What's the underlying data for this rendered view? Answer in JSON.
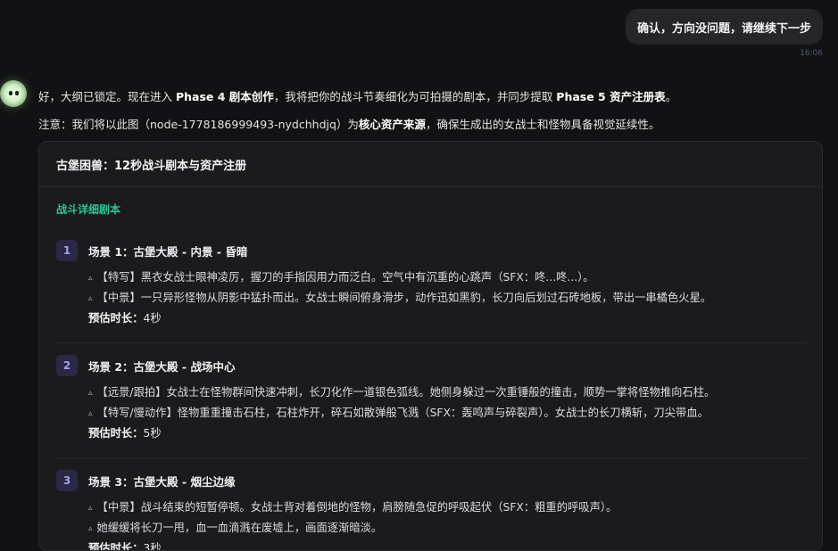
{
  "user_message": {
    "text": "确认，方向没问题，请继续下一步",
    "time": "16:06"
  },
  "assistant": {
    "intro_parts": [
      "好，大纲已锁定。现在进入 ",
      "Phase 4 剧本创作",
      "，我将把你的战斗节奏细化为可拍摄的剧本，并同步提取 ",
      "Phase 5 资产注册表",
      "。"
    ],
    "note_parts": [
      "注意：我们将以此图（node-1778186999493-nydchhdjq）为",
      "核心资产来源",
      "，确保生成出的女战士和怪物具备视觉延续性。"
    ]
  },
  "card": {
    "title": "古堡困兽：12秒战斗剧本与资产注册",
    "section_title": "战斗详细剧本",
    "duration_label": "预估时长：",
    "scenes": [
      {
        "num": "1",
        "title": "场景 1：古堡大殿 - 内景 - 昏暗",
        "shots": [
          "【特写】黑衣女战士眼神凌厉，握刀的手指因用力而泛白。空气中有沉重的心跳声（SFX：咚...咚...）。",
          "【中景】一只异形怪物从阴影中猛扑而出。女战士瞬间俯身滑步，动作迅如黑豹，长刀向后划过石砖地板，带出一串橘色火星。"
        ],
        "duration": "4秒"
      },
      {
        "num": "2",
        "title": "场景 2：古堡大殿 - 战场中心",
        "shots": [
          "【远景/跟拍】女战士在怪物群间快速冲刺，长刀化作一道银色弧线。她侧身躲过一次重锤般的撞击，顺势一掌将怪物推向石柱。",
          "【特写/慢动作】怪物重重撞击石柱，石柱炸开，碎石如散弹般飞溅（SFX：轰鸣声与碎裂声）。女战士的长刀横斩，刀尖带血。"
        ],
        "duration": "5秒"
      },
      {
        "num": "3",
        "title": "场景 3：古堡大殿 - 烟尘边缘",
        "shots": [
          "【中景】战斗结束的短暂停顿。女战士背对着倒地的怪物，肩膀随急促的呼吸起伏（SFX：粗重的呼吸声）。",
          "她缓缓将长刀一甩，血一血滴溅在废墟上，画面逐渐暗淡。"
        ],
        "duration": "3秒"
      }
    ]
  }
}
